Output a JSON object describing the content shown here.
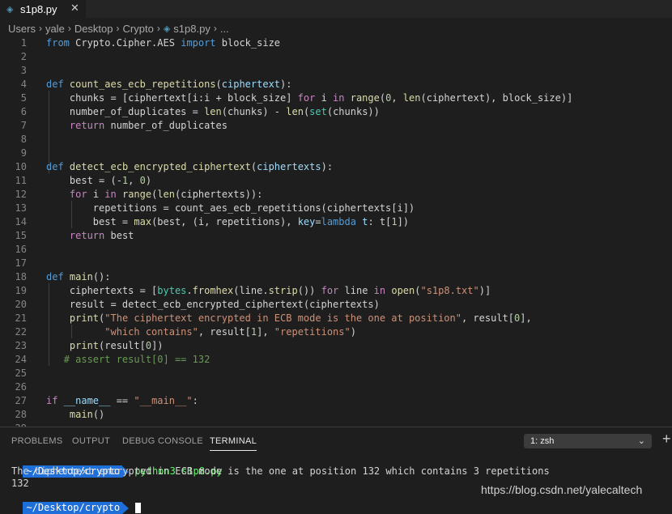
{
  "tab": {
    "filename": "s1p8.py",
    "close": "✕",
    "icon": "python-icon"
  },
  "breadcrumb": [
    "Users",
    "yale",
    "Desktop",
    "Crypto",
    "s1p8.py",
    "..."
  ],
  "code_lines": [
    {
      "n": "1",
      "tokens": [
        [
          "kw",
          "from"
        ],
        [
          "txt",
          " Crypto.Cipher.AES "
        ],
        [
          "kw",
          "import"
        ],
        [
          "txt",
          " block_size"
        ]
      ]
    },
    {
      "n": "2",
      "tokens": []
    },
    {
      "n": "3",
      "tokens": []
    },
    {
      "n": "4",
      "tokens": [
        [
          "kw",
          "def"
        ],
        [
          "txt",
          " "
        ],
        [
          "fn",
          "count_aes_ecb_repetitions"
        ],
        [
          "txt",
          "("
        ],
        [
          "var",
          "ciphertext"
        ],
        [
          "txt",
          "):"
        ]
      ]
    },
    {
      "n": "5",
      "tokens": [
        [
          "txt",
          "    chunks = [ciphertext[i:i + block_size] "
        ],
        [
          "ctl",
          "for"
        ],
        [
          "txt",
          " i "
        ],
        [
          "ctl",
          "in"
        ],
        [
          "txt",
          " "
        ],
        [
          "fn",
          "range"
        ],
        [
          "txt",
          "("
        ],
        [
          "num",
          "0"
        ],
        [
          "txt",
          ", "
        ],
        [
          "fn",
          "len"
        ],
        [
          "txt",
          "(ciphertext), block_size)]"
        ]
      ]
    },
    {
      "n": "6",
      "tokens": [
        [
          "txt",
          "    number_of_duplicates = "
        ],
        [
          "fn",
          "len"
        ],
        [
          "txt",
          "(chunks) - "
        ],
        [
          "fn",
          "len"
        ],
        [
          "txt",
          "("
        ],
        [
          "bi",
          "set"
        ],
        [
          "txt",
          "(chunks))"
        ]
      ]
    },
    {
      "n": "7",
      "tokens": [
        [
          "txt",
          "    "
        ],
        [
          "ctl",
          "return"
        ],
        [
          "txt",
          " number_of_duplicates"
        ]
      ]
    },
    {
      "n": "8",
      "tokens": []
    },
    {
      "n": "9",
      "tokens": []
    },
    {
      "n": "10",
      "tokens": [
        [
          "kw",
          "def"
        ],
        [
          "txt",
          " "
        ],
        [
          "fn",
          "detect_ecb_encrypted_ciphertext"
        ],
        [
          "txt",
          "("
        ],
        [
          "var",
          "ciphertexts"
        ],
        [
          "txt",
          "):"
        ]
      ]
    },
    {
      "n": "11",
      "tokens": [
        [
          "txt",
          "    best = (-"
        ],
        [
          "num",
          "1"
        ],
        [
          "txt",
          ", "
        ],
        [
          "num",
          "0"
        ],
        [
          "txt",
          ")"
        ]
      ]
    },
    {
      "n": "12",
      "tokens": [
        [
          "txt",
          "    "
        ],
        [
          "ctl",
          "for"
        ],
        [
          "txt",
          " i "
        ],
        [
          "ctl",
          "in"
        ],
        [
          "txt",
          " "
        ],
        [
          "fn",
          "range"
        ],
        [
          "txt",
          "("
        ],
        [
          "fn",
          "len"
        ],
        [
          "txt",
          "(ciphertexts)):"
        ]
      ]
    },
    {
      "n": "13",
      "tokens": [
        [
          "txt",
          "        repetitions = count_aes_ecb_repetitions(ciphertexts[i])"
        ]
      ]
    },
    {
      "n": "14",
      "tokens": [
        [
          "txt",
          "        best = "
        ],
        [
          "fn",
          "max"
        ],
        [
          "txt",
          "(best, (i, repetitions), "
        ],
        [
          "var",
          "key"
        ],
        [
          "txt",
          "="
        ],
        [
          "kw",
          "lambda"
        ],
        [
          "txt",
          " "
        ],
        [
          "var",
          "t"
        ],
        [
          "txt",
          ": t["
        ],
        [
          "num",
          "1"
        ],
        [
          "txt",
          "])"
        ]
      ]
    },
    {
      "n": "15",
      "tokens": [
        [
          "txt",
          "    "
        ],
        [
          "ctl",
          "return"
        ],
        [
          "txt",
          " best"
        ]
      ]
    },
    {
      "n": "16",
      "tokens": []
    },
    {
      "n": "17",
      "tokens": []
    },
    {
      "n": "18",
      "tokens": [
        [
          "kw",
          "def"
        ],
        [
          "txt",
          " "
        ],
        [
          "fn",
          "main"
        ],
        [
          "txt",
          "():"
        ]
      ]
    },
    {
      "n": "19",
      "tokens": [
        [
          "txt",
          "    ciphertexts = ["
        ],
        [
          "bi",
          "bytes"
        ],
        [
          "txt",
          "."
        ],
        [
          "fn",
          "fromhex"
        ],
        [
          "txt",
          "(line."
        ],
        [
          "fn",
          "strip"
        ],
        [
          "txt",
          "()) "
        ],
        [
          "ctl",
          "for"
        ],
        [
          "txt",
          " line "
        ],
        [
          "ctl",
          "in"
        ],
        [
          "txt",
          " "
        ],
        [
          "fn",
          "open"
        ],
        [
          "txt",
          "("
        ],
        [
          "str",
          "\"s1p8.txt\""
        ],
        [
          "txt",
          ")]"
        ]
      ]
    },
    {
      "n": "20",
      "tokens": [
        [
          "txt",
          "    result = detect_ecb_encrypted_ciphertext(ciphertexts)"
        ]
      ]
    },
    {
      "n": "21",
      "tokens": [
        [
          "txt",
          "    "
        ],
        [
          "fn",
          "print"
        ],
        [
          "txt",
          "("
        ],
        [
          "str",
          "\"The ciphertext encrypted in ECB mode is the one at position\""
        ],
        [
          "txt",
          ", result["
        ],
        [
          "num",
          "0"
        ],
        [
          "txt",
          "],"
        ]
      ]
    },
    {
      "n": "22",
      "tokens": [
        [
          "txt",
          "          "
        ],
        [
          "str",
          "\"which contains\""
        ],
        [
          "txt",
          ", result["
        ],
        [
          "num",
          "1"
        ],
        [
          "txt",
          "], "
        ],
        [
          "str",
          "\"repetitions\""
        ],
        [
          "txt",
          ")"
        ]
      ]
    },
    {
      "n": "23",
      "tokens": [
        [
          "txt",
          "    "
        ],
        [
          "fn",
          "print"
        ],
        [
          "txt",
          "(result["
        ],
        [
          "num",
          "0"
        ],
        [
          "txt",
          "])"
        ]
      ]
    },
    {
      "n": "24",
      "tokens": [
        [
          "txt",
          "   "
        ],
        [
          "cm",
          "# assert result[0] == 132"
        ]
      ]
    },
    {
      "n": "25",
      "tokens": []
    },
    {
      "n": "26",
      "tokens": []
    },
    {
      "n": "27",
      "tokens": [
        [
          "ctl",
          "if"
        ],
        [
          "txt",
          " "
        ],
        [
          "var",
          "__name__"
        ],
        [
          "txt",
          " == "
        ],
        [
          "str",
          "\"__main__\""
        ],
        [
          "txt",
          ":"
        ]
      ]
    },
    {
      "n": "28",
      "tokens": [
        [
          "txt",
          "    "
        ],
        [
          "fn",
          "main"
        ],
        [
          "txt",
          "()"
        ]
      ]
    },
    {
      "n": "29",
      "tokens": []
    }
  ],
  "panel": {
    "tabs": [
      "PROBLEMS",
      "OUTPUT",
      "DEBUG CONSOLE",
      "TERMINAL"
    ],
    "active_tab": "TERMINAL",
    "shell_select": "1: zsh",
    "chevron": "⌄",
    "plus": "+"
  },
  "terminal": {
    "prompt": "~/Desktop/crypto",
    "command": "python3 s1p8.py",
    "output_1": "The ciphertext encrypted in ECB mode is the one at position 132 which contains 3 repetitions",
    "output_2": "132",
    "prompt_2": "~/Desktop/crypto"
  },
  "watermark": "https://blog.csdn.net/yalecaltech",
  "colors": {
    "background": "#1e1e1e",
    "prompt_bg": "#1e6fd9",
    "command": "#5ff967"
  }
}
